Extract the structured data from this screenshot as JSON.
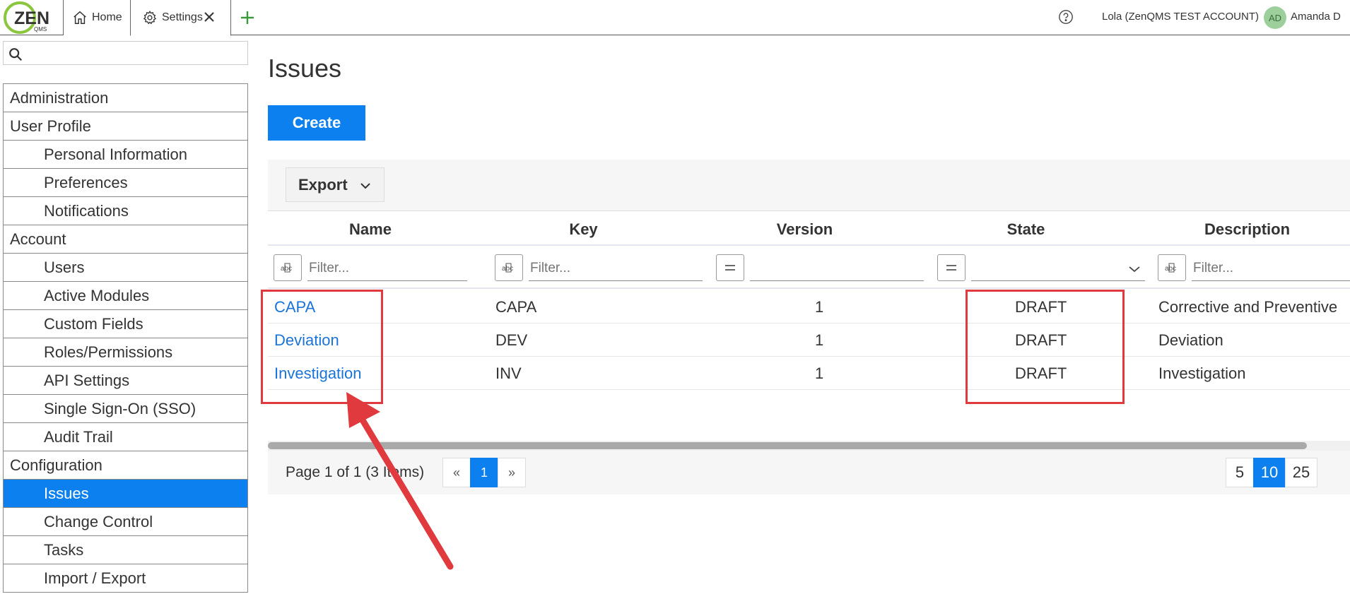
{
  "header": {
    "logo_text": "ZEN",
    "logo_sub": "QMS",
    "tabs": [
      {
        "label": "Home",
        "icon": "home-icon"
      },
      {
        "label": "Settings",
        "icon": "gear-icon",
        "closable": true
      }
    ],
    "account": "Lola (ZenQMS TEST ACCOUNT)",
    "avatar_initials": "AD",
    "user_name": "Amanda D"
  },
  "sidebar": {
    "search_placeholder": "",
    "items": [
      {
        "label": "Administration",
        "level": "section"
      },
      {
        "label": "User Profile",
        "level": "section"
      },
      {
        "label": "Personal Information",
        "level": "sub"
      },
      {
        "label": "Preferences",
        "level": "sub"
      },
      {
        "label": "Notifications",
        "level": "sub"
      },
      {
        "label": "Account",
        "level": "section"
      },
      {
        "label": "Users",
        "level": "sub"
      },
      {
        "label": "Active Modules",
        "level": "sub"
      },
      {
        "label": "Custom Fields",
        "level": "sub"
      },
      {
        "label": "Roles/Permissions",
        "level": "sub"
      },
      {
        "label": "API Settings",
        "level": "sub"
      },
      {
        "label": "Single Sign-On (SSO)",
        "level": "sub"
      },
      {
        "label": "Audit Trail",
        "level": "sub"
      },
      {
        "label": "Configuration",
        "level": "section"
      },
      {
        "label": "Issues",
        "level": "sub",
        "active": true
      },
      {
        "label": "Change Control",
        "level": "sub"
      },
      {
        "label": "Tasks",
        "level": "sub"
      },
      {
        "label": "Import / Export",
        "level": "sub"
      }
    ]
  },
  "main": {
    "title": "Issues",
    "create_label": "Create",
    "export_label": "Export",
    "columns": [
      "Name",
      "Key",
      "Version",
      "State",
      "Description"
    ],
    "filter_placeholder": "Filter...",
    "rows": [
      {
        "name": "CAPA",
        "key": "CAPA",
        "version": "1",
        "state": "DRAFT",
        "description": "Corrective and Preventive"
      },
      {
        "name": "Deviation",
        "key": "DEV",
        "version": "1",
        "state": "DRAFT",
        "description": "Deviation"
      },
      {
        "name": "Investigation",
        "key": "INV",
        "version": "1",
        "state": "DRAFT",
        "description": "Investigation"
      }
    ],
    "pager": {
      "info": "Page 1 of 1 (3 Items)",
      "prev": "«",
      "current": "1",
      "next": "»",
      "sizes": [
        "5",
        "10",
        "25"
      ],
      "active_size": "10"
    }
  },
  "colors": {
    "accent": "#0c80ef",
    "link": "#1a73d8",
    "annotation": "#e0393e",
    "logo_green": "#8cc63f"
  }
}
